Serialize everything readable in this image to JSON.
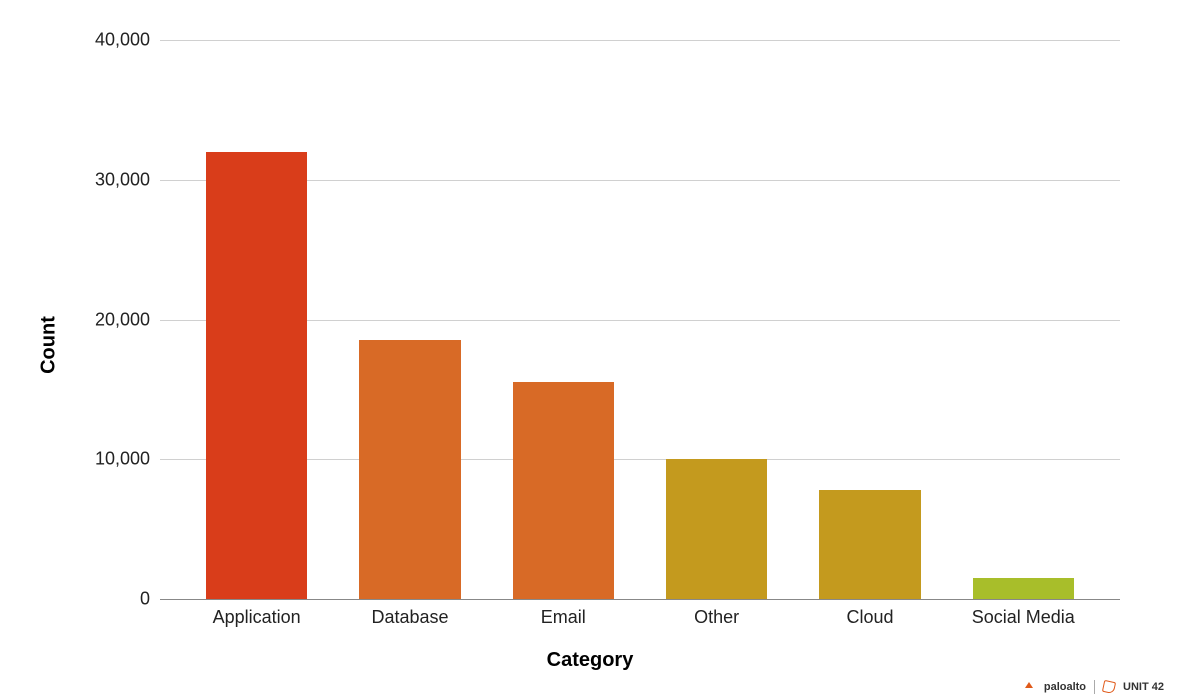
{
  "chart_data": {
    "type": "bar",
    "categories": [
      "Application",
      "Database",
      "Email",
      "Other",
      "Cloud",
      "Social Media"
    ],
    "values": [
      32000,
      18500,
      15500,
      10000,
      7800,
      1500
    ],
    "colors": [
      "#d93d1a",
      "#d86a26",
      "#d86a26",
      "#c49a1e",
      "#c49a1e",
      "#a8be2a"
    ],
    "xlabel": "Category",
    "ylabel": "Count",
    "ylim": [
      0,
      40000
    ],
    "yticks": [
      0,
      10000,
      20000,
      30000,
      40000
    ],
    "ytick_labels": [
      "0",
      "10,000",
      "20,000",
      "30,000",
      "40,000"
    ]
  },
  "footer": {
    "brand1": "paloalto",
    "brand2": "UNIT 42"
  }
}
